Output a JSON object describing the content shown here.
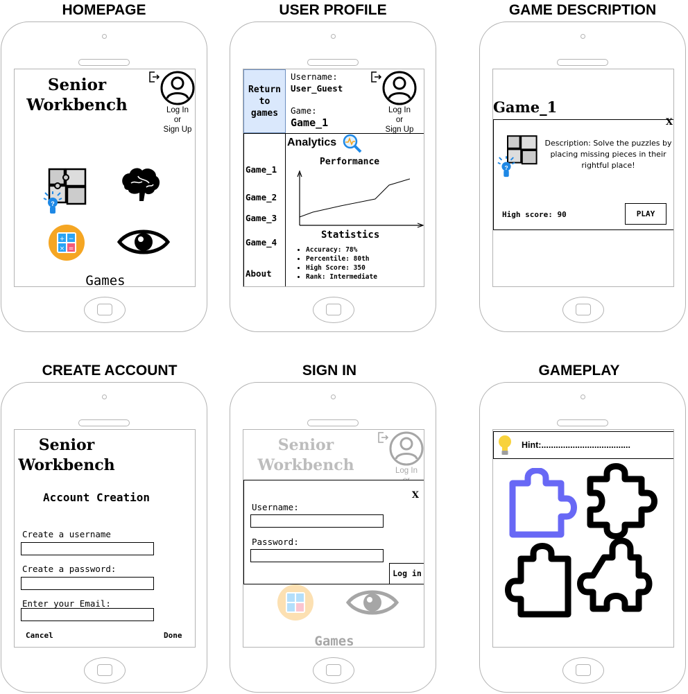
{
  "screens": {
    "homepage": {
      "heading": "HOMEPAGE",
      "app_title": "Senior Workbench",
      "login_text": [
        "Log In",
        "or",
        "Sign Up"
      ],
      "games_label": "Games"
    },
    "user_profile": {
      "heading": "USER PROFILE",
      "return_label": "Return to games",
      "username_label": "Username:",
      "username_value": "User_Guest",
      "game_label": "Game:",
      "game_value": "Game_1",
      "login_text": [
        "Log In",
        "or",
        "Sign Up"
      ],
      "nav_items": [
        "Game_1",
        "Game_2",
        "Game_3",
        "Game_4",
        "About"
      ],
      "analytics_label": "Analytics",
      "performance_label": "Performance",
      "statistics_label": "Statistics",
      "stats": [
        "Accuracy: 78%",
        "Percentile: 80th",
        "High Score: 350",
        "Rank: Intermediate"
      ]
    },
    "game_description": {
      "heading": "GAME DESCRIPTION",
      "game_title": "Game_1",
      "close": "X",
      "description": "Description: Solve the puzzles by placing missing pieces in their rightful place!",
      "high_score": "High score: 90",
      "play": "PLAY"
    },
    "create_account": {
      "heading": "CREATE ACCOUNT",
      "app_title": "Senior Workbench",
      "form_title": "Account Creation",
      "username_label": "Create a username",
      "password_label": "Create a password:",
      "email_label": "Enter your Email:",
      "cancel": "Cancel",
      "done": "Done"
    },
    "sign_in": {
      "heading": "SIGN IN",
      "app_title": "Senior Workbench",
      "login_text": [
        "Log In",
        "or"
      ],
      "close": "X",
      "username_label": "Username:",
      "password_label": "Password:",
      "login_button": "Log in",
      "games_label": "Games"
    },
    "gameplay": {
      "heading": "GAMEPLAY",
      "hint": "Hint:....................................."
    }
  },
  "colors": {
    "border": "#b3b3b3",
    "accent_blue": "#6868f5",
    "return_bg": "#dae8fc",
    "calc_orange": "#f5a623",
    "bulb_yellow": "#f8d23c"
  },
  "icons": [
    "logout-icon",
    "user-icon",
    "puzzle-icon",
    "lightbulb-icon",
    "brain-icon",
    "calculator-icon",
    "eye-icon",
    "analytics-icon",
    "puzzle-piece-icon"
  ]
}
